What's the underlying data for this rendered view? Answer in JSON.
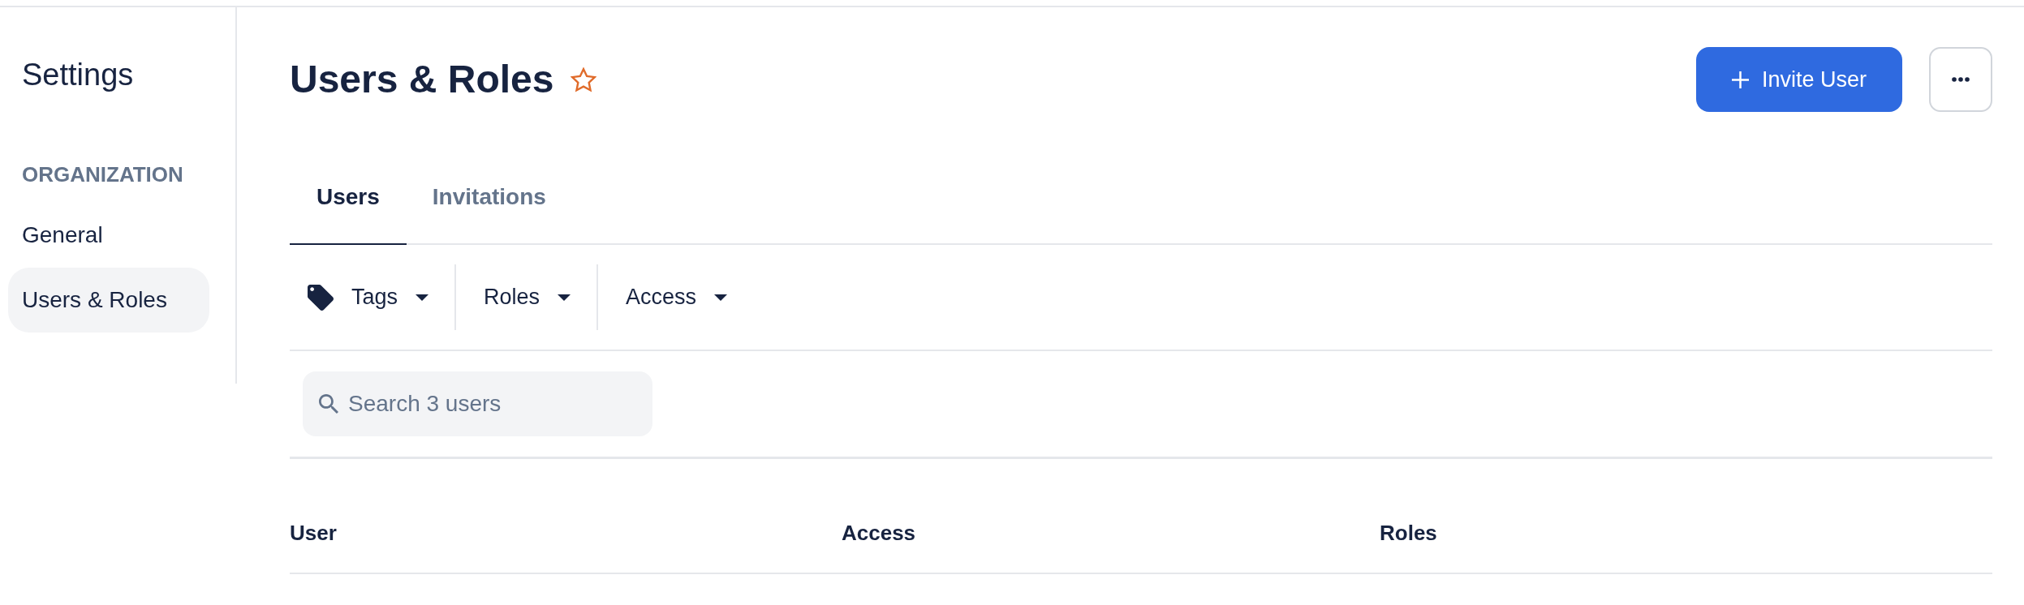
{
  "sidebar": {
    "title": "Settings",
    "sections": [
      {
        "heading": "ORGANIZATION",
        "items": [
          {
            "label": "General",
            "selected": false
          },
          {
            "label": "Users & Roles",
            "selected": true
          }
        ]
      }
    ]
  },
  "header": {
    "title": "Users & Roles",
    "favorite": false,
    "primary_button": {
      "label": "Invite User"
    }
  },
  "tabs": [
    {
      "label": "Users",
      "selected": true
    },
    {
      "label": "Invitations",
      "selected": false
    }
  ],
  "filters": [
    {
      "kind": "icon",
      "label": "Tags"
    },
    {
      "kind": "plain",
      "label": "Roles"
    },
    {
      "kind": "plain",
      "label": "Access"
    }
  ],
  "search": {
    "placeholder": "Search 3 users"
  },
  "table": {
    "columns": [
      "User",
      "Access",
      "Roles"
    ]
  }
}
